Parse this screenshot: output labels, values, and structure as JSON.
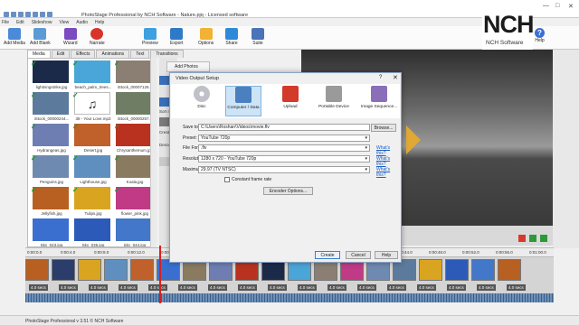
{
  "app": {
    "title": "PhotoStage Professional by NCH Software - Nature.pjq - Licensed software"
  },
  "menu": [
    "File",
    "Edit",
    "Slideshow",
    "View",
    "Audio",
    "Help"
  ],
  "ribbon": {
    "buttons": [
      {
        "label": "Add Media",
        "color": "#4a8ad8"
      },
      {
        "label": "Add Blank",
        "color": "#5b9bd5"
      },
      {
        "label": "Wizard",
        "color": "#7c4bbf"
      },
      {
        "label": "Narrate",
        "color": "#d9342b"
      },
      {
        "label": "Preview",
        "color": "#3da0e0"
      },
      {
        "label": "Export",
        "color": "#2f7ac8"
      },
      {
        "label": "Options",
        "color": "#f2b233"
      },
      {
        "label": "Share",
        "color": "#2e8ad8"
      },
      {
        "label": "Suite",
        "color": "#4a73b8"
      }
    ],
    "logo_text": "NCH",
    "logo_sub": "NCH Software",
    "help_label": "Help"
  },
  "left_tabs": [
    "Media",
    "Edit",
    "Effects",
    "Animations",
    "Text",
    "Transitions"
  ],
  "media_items": [
    {
      "caption": "lightningstrike.jpg",
      "color": "#1c2a4a",
      "check": true
    },
    {
      "caption": "beach_palm_trees...",
      "color": "#4aa6d8",
      "check": true
    },
    {
      "caption": "iStock_00007126...",
      "color": "#8a7f72",
      "check": true
    },
    {
      "caption": "iStock_00000244...",
      "color": "#5c7a9c",
      "check": true
    },
    {
      "caption": "38 - Your Love.mp3",
      "color": "#ffffff",
      "check": true
    },
    {
      "caption": "iStock_00000257...",
      "color": "#6f7d65",
      "check": false
    },
    {
      "caption": "Hydrangeas.jpg",
      "color": "#6f7eb2",
      "check": true
    },
    {
      "caption": "Desert.jpg",
      "color": "#c0602a",
      "check": true
    },
    {
      "caption": "Chrysanthemum.jpg",
      "color": "#b8321f",
      "check": true
    },
    {
      "caption": "Penguins.jpg",
      "color": "#6f8ab0",
      "check": true
    },
    {
      "caption": "Lighthouse.jpg",
      "color": "#5f8fbf",
      "check": true
    },
    {
      "caption": "Koala.jpg",
      "color": "#8a7a60",
      "check": true
    },
    {
      "caption": "Jellyfish.jpg",
      "color": "#b85f22",
      "check": true
    },
    {
      "caption": "Tulips.jpg",
      "color": "#d9a520",
      "check": true
    },
    {
      "caption": "flower_pink.jpg",
      "color": "#c03a86",
      "check": true
    },
    {
      "caption": "Sky_043.jpg",
      "color": "#3a6fd0",
      "check": false
    },
    {
      "caption": "Sky_035.jpg",
      "color": "#2c5ab8",
      "check": false
    },
    {
      "caption": "Sky_044.jpg",
      "color": "#4277c9",
      "check": false
    }
  ],
  "sidebar": {
    "add_photos": "Add Photos",
    "sort": "Sort me",
    "create": "Creat",
    "descend": "Descen"
  },
  "dialog": {
    "title": "Video Output Setup",
    "targets": [
      {
        "label": "Disc",
        "color": "#c0c0c8"
      },
      {
        "label": "Computer / Data",
        "color": "#4a7fc0",
        "selected": true
      },
      {
        "label": "Upload",
        "color": "#d23a2a"
      },
      {
        "label": "Portable Device",
        "color": "#9a9a9a"
      },
      {
        "label": "Image Sequence...",
        "color": "#8a6fb8"
      }
    ],
    "save_label": "Save to:",
    "save_value": "C:\\Users\\Roshan\\Videos\\movie.flv",
    "browse": "Browse...",
    "preset_label": "Preset:",
    "preset_value": "YouTube 720p",
    "format_label": "File Format:",
    "format_value": ".flv",
    "resolution_label": "Resolution:",
    "resolution_value": "1280 x 720 - YouTube 720p",
    "framerate_label": "Maximum Frame Rate:",
    "framerate_value": "29.97 (TV NTSC)",
    "constant_label": "Constant frame rate",
    "encoder_btn": "Encoder Options...",
    "whats_this": "What's this?",
    "create": "Create",
    "cancel": "Cancel",
    "help": "Help"
  },
  "timeline": {
    "ruler": [
      "0:00:0.0",
      "0:00:4.0",
      "0:00:8.0",
      "0:00:12.0",
      "0:00:16.0",
      "0:00:20.0",
      "0:00:24.0",
      "0:00:28.0",
      "0:00:32.0",
      "0:00:36.0",
      "0:00:40.0",
      "0:00:44.0",
      "0:00:48.0",
      "0:00:52.0",
      "0:00:56.0",
      "0:01:00.0"
    ],
    "clip_colors": [
      "#b85f22",
      "#2a3d6b",
      "#d9a520",
      "#5f8fbf",
      "#c0602a",
      "#3a6fd0",
      "#8a7a60",
      "#6f7eb2",
      "#b8321f",
      "#1c2a4a",
      "#4aa6d8",
      "#8a7f72",
      "#c03a86",
      "#6f8ab0",
      "#5c7a9c",
      "#d9a520",
      "#2c5ab8",
      "#4277c9",
      "#b85f22"
    ],
    "duration": "4.0 secs"
  },
  "status": "PhotoStage Professional v 3.51 © NCH Software"
}
